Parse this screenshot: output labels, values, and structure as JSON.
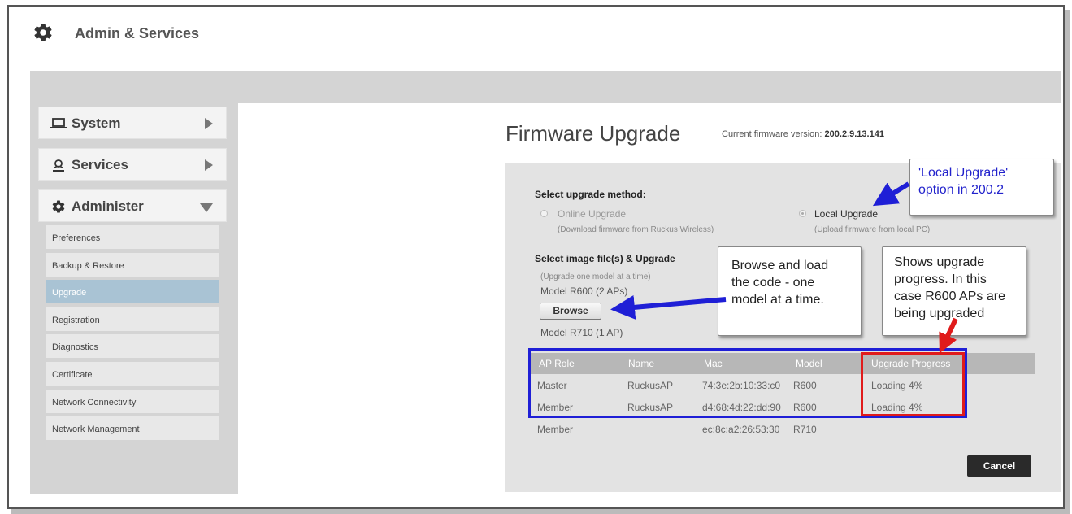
{
  "header": {
    "title": "Admin & Services",
    "icon": "gear-icon"
  },
  "sidebar": {
    "sections": [
      {
        "label": "System",
        "icon": "laptop-icon",
        "state": "collapsed"
      },
      {
        "label": "Services",
        "icon": "services-icon",
        "state": "collapsed"
      },
      {
        "label": "Administer",
        "icon": "gear-icon",
        "state": "expanded"
      }
    ],
    "items": [
      {
        "label": "Preferences"
      },
      {
        "label": "Backup & Restore"
      },
      {
        "label": "Upgrade",
        "active": true
      },
      {
        "label": "Registration"
      },
      {
        "label": "Diagnostics"
      },
      {
        "label": "Certificate"
      },
      {
        "label": "Network Connectivity"
      },
      {
        "label": "Network Management"
      }
    ]
  },
  "main": {
    "title": "Firmware Upgrade",
    "version_label": "Current firmware version:",
    "version_value": "200.2.9.13.141",
    "method_heading": "Select upgrade method:",
    "online": {
      "label": "Online Upgrade",
      "note": "(Download firmware from Ruckus Wireless)",
      "selected": false
    },
    "local": {
      "label": "Local Upgrade",
      "note": "(Upload firmware from local PC)",
      "selected": true
    },
    "image_heading": "Select image file(s) & Upgrade",
    "image_note": "(Upgrade one model at a time)",
    "model_a": "Model R600 (2 APs)",
    "browse_label": "Browse",
    "model_b": "Model R710 (1 AP)",
    "table": {
      "headers": [
        "AP Role",
        "Name",
        "Mac",
        "Model",
        "Upgrade Progress"
      ],
      "rows": [
        [
          "Master",
          "RuckusAP",
          "74:3e:2b:10:33:c0",
          "R600",
          "Loading 4%"
        ],
        [
          "Member",
          "RuckusAP",
          "d4:68:4d:22:dd:90",
          "R600",
          "Loading 4%"
        ],
        [
          "Member",
          "",
          "ec:8c:a2:26:53:30",
          "R710",
          ""
        ]
      ]
    },
    "cancel_label": "Cancel"
  },
  "annotations": {
    "local_upgrade_line1": "'Local Upgrade'",
    "local_upgrade_line2": "option in 200.2",
    "browse_line1": "Browse and load",
    "browse_line2": "the code - one",
    "browse_line3": "model at a time.",
    "progress_line1": "Shows upgrade",
    "progress_line2": "progress. In this",
    "progress_line3": "case R600 APs are",
    "progress_line4": "being upgraded"
  },
  "colors": {
    "accent_active": "#a9c3d4",
    "callout_blue": "#1f1fd6",
    "callout_red": "#e01b1b"
  }
}
